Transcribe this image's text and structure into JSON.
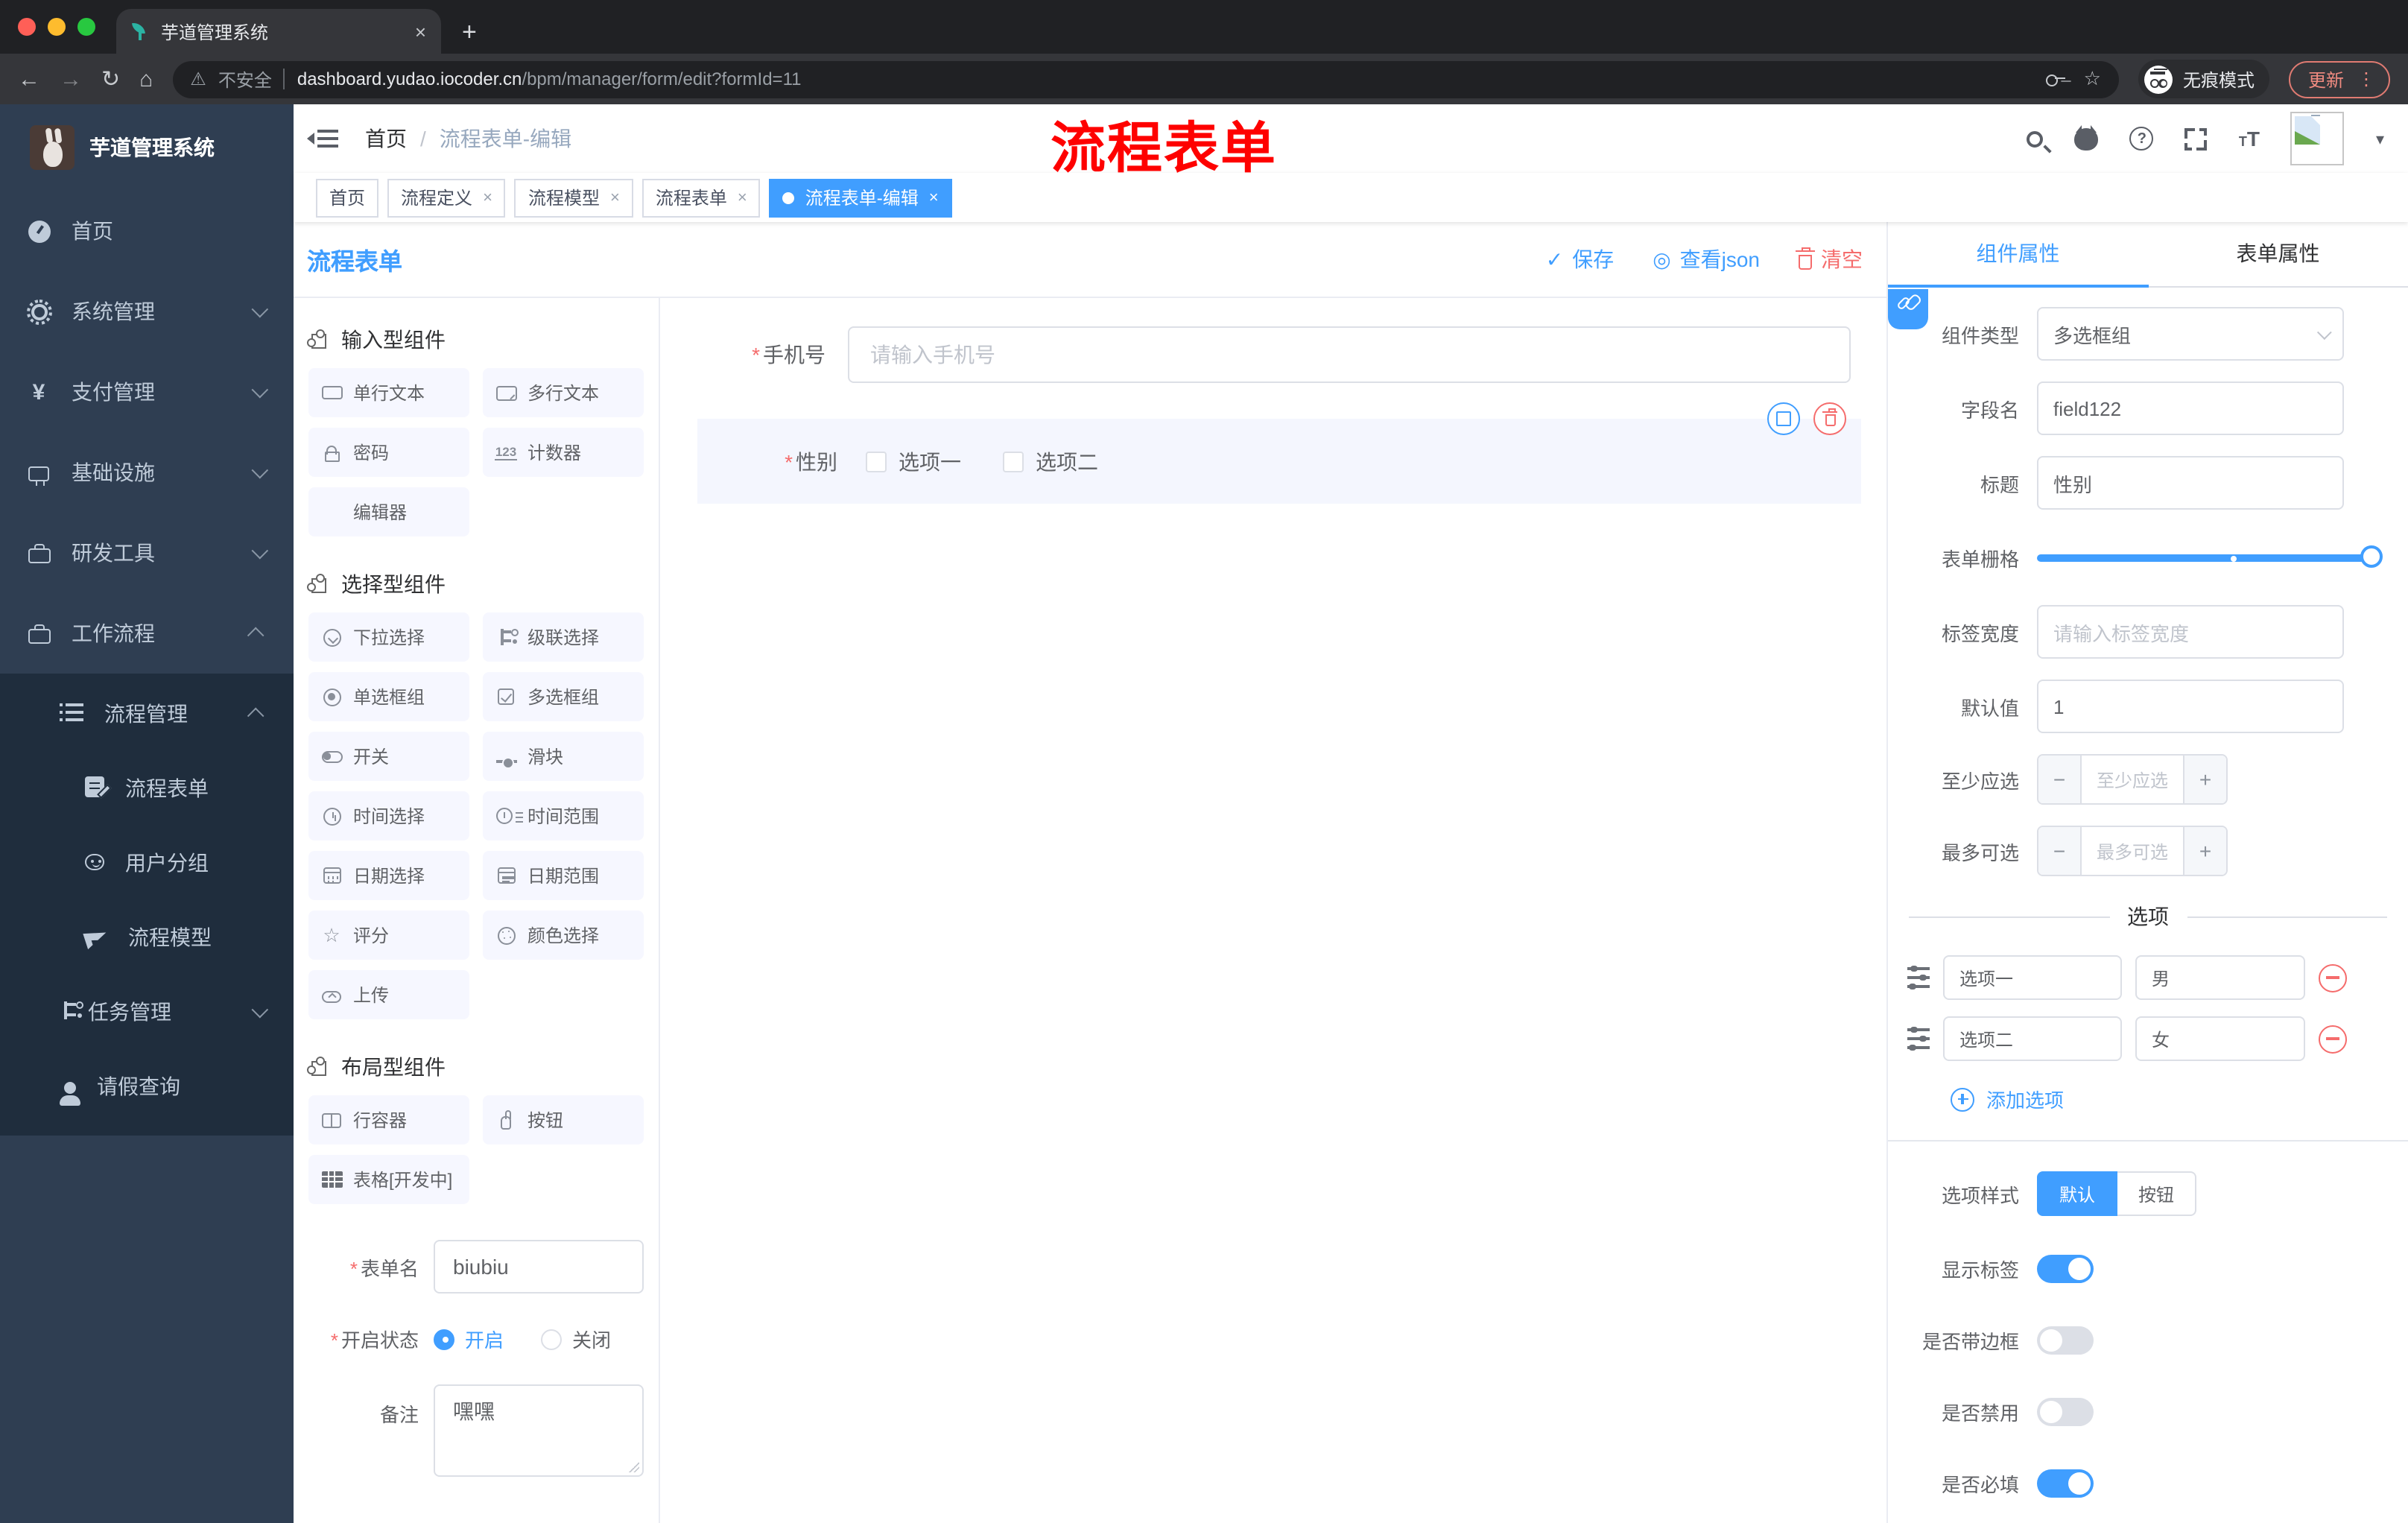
{
  "colors": {
    "accent": "#409eff",
    "danger": "#f56c6c",
    "annotation_red": "#fe0100",
    "sidebar_bg": "#2f3e52",
    "submenu_bg": "#1f2d3d",
    "active_tag_bg": "#409eff"
  },
  "chrome": {
    "tab_title": "芋道管理系统",
    "security_label": "不安全",
    "url_host": "dashboard.yudao.iocoder.cn",
    "url_path": "/bpm/manager/form/edit?formId=11",
    "incognito_label": "无痕模式",
    "update_label": "更新"
  },
  "sidebar": {
    "logo_title": "芋道管理系统",
    "items": [
      {
        "label": "首页",
        "icon": "dashboard-icon"
      },
      {
        "label": "系统管理",
        "icon": "gear-icon"
      },
      {
        "label": "支付管理",
        "icon": "yen-icon"
      },
      {
        "label": "基础设施",
        "icon": "monitor-icon"
      },
      {
        "label": "研发工具",
        "icon": "toolbox-icon"
      },
      {
        "label": "工作流程",
        "icon": "briefcase-icon"
      }
    ],
    "submenu": [
      {
        "label": "流程管理",
        "icon": "list-icon"
      },
      {
        "label": "流程表单",
        "icon": "document-edit-icon"
      },
      {
        "label": "用户分组",
        "icon": "people-icon"
      },
      {
        "label": "流程模型",
        "icon": "paper-plane-icon"
      },
      {
        "label": "任务管理",
        "icon": "tree-icon"
      },
      {
        "label": "请假查询",
        "icon": "person-icon"
      }
    ]
  },
  "navbar": {
    "breadcrumb_home": "首页",
    "breadcrumb_current": "流程表单-编辑",
    "annotation": "流程表单"
  },
  "tags": [
    {
      "label": "首页"
    },
    {
      "label": "流程定义"
    },
    {
      "label": "流程模型"
    },
    {
      "label": "流程表单"
    },
    {
      "label": "流程表单-编辑"
    }
  ],
  "form_header": {
    "title": "流程表单",
    "save_label": "保存",
    "view_json_label": "查看json",
    "clear_label": "清空",
    "view_json_icon": "◎",
    "save_icon": "✓"
  },
  "components_panel": {
    "sections": [
      {
        "title": "输入型组件",
        "items": [
          {
            "label": "单行文本",
            "icon": "text-input-icon"
          },
          {
            "label": "多行文本",
            "icon": "textarea-icon"
          },
          {
            "label": "密码",
            "icon": "lock-icon"
          },
          {
            "label": "计数器",
            "icon": "counter-icon"
          },
          {
            "label": "编辑器",
            "icon": "editor-icon"
          }
        ]
      },
      {
        "title": "选择型组件",
        "items": [
          {
            "label": "下拉选择",
            "icon": "select-icon"
          },
          {
            "label": "级联选择",
            "icon": "cascader-icon"
          },
          {
            "label": "单选框组",
            "icon": "radio-icon"
          },
          {
            "label": "多选框组",
            "icon": "checkbox-icon"
          },
          {
            "label": "开关",
            "icon": "switch-icon"
          },
          {
            "label": "滑块",
            "icon": "slider-icon"
          },
          {
            "label": "时间选择",
            "icon": "time-icon"
          },
          {
            "label": "时间范围",
            "icon": "time-range-icon"
          },
          {
            "label": "日期选择",
            "icon": "date-icon"
          },
          {
            "label": "日期范围",
            "icon": "date-range-icon"
          },
          {
            "label": "评分",
            "icon": "star-icon",
            "glyph": "☆"
          },
          {
            "label": "颜色选择",
            "icon": "palette-icon"
          },
          {
            "label": "上传",
            "icon": "upload-icon"
          }
        ]
      },
      {
        "title": "布局型组件",
        "items": [
          {
            "label": "行容器",
            "icon": "row-container-icon"
          },
          {
            "label": "按钮",
            "icon": "button-hand-icon"
          },
          {
            "label": "表格[开发中]",
            "icon": "table-icon"
          }
        ]
      }
    ],
    "form_name_label": "表单名",
    "form_name_value": "biubiu",
    "status_label": "开启状态",
    "status_on": "开启",
    "status_off": "关闭",
    "remark_label": "备注",
    "remark_value": "嘿嘿"
  },
  "canvas": {
    "phone_label": "手机号",
    "phone_placeholder": "请输入手机号",
    "gender_label": "性别",
    "gender_option1": "选项一",
    "gender_option2": "选项二"
  },
  "props_panel": {
    "tab_component": "组件属性",
    "tab_form": "表单属性",
    "component_type_label": "组件类型",
    "component_type_value": "多选框组",
    "field_name_label": "字段名",
    "field_name_value": "field122",
    "title_label": "标题",
    "title_value": "性别",
    "grid_label": "表单栅格",
    "label_width_label": "标签宽度",
    "label_width_placeholder": "请输入标签宽度",
    "default_label": "默认值",
    "default_value": "1",
    "min_label": "至少应选",
    "min_placeholder": "至少应选",
    "max_label": "最多可选",
    "max_placeholder": "最多可选",
    "options_divider": "选项",
    "options": [
      {
        "label": "选项一",
        "value": "男"
      },
      {
        "label": "选项二",
        "value": "女"
      }
    ],
    "add_option_label": "添加选项",
    "style_label": "选项样式",
    "style_default": "默认",
    "style_button": "按钮",
    "toggle_show_label": "显示标签",
    "toggle_border": "是否带边框",
    "toggle_disabled": "是否禁用",
    "toggle_required": "是否必填"
  }
}
